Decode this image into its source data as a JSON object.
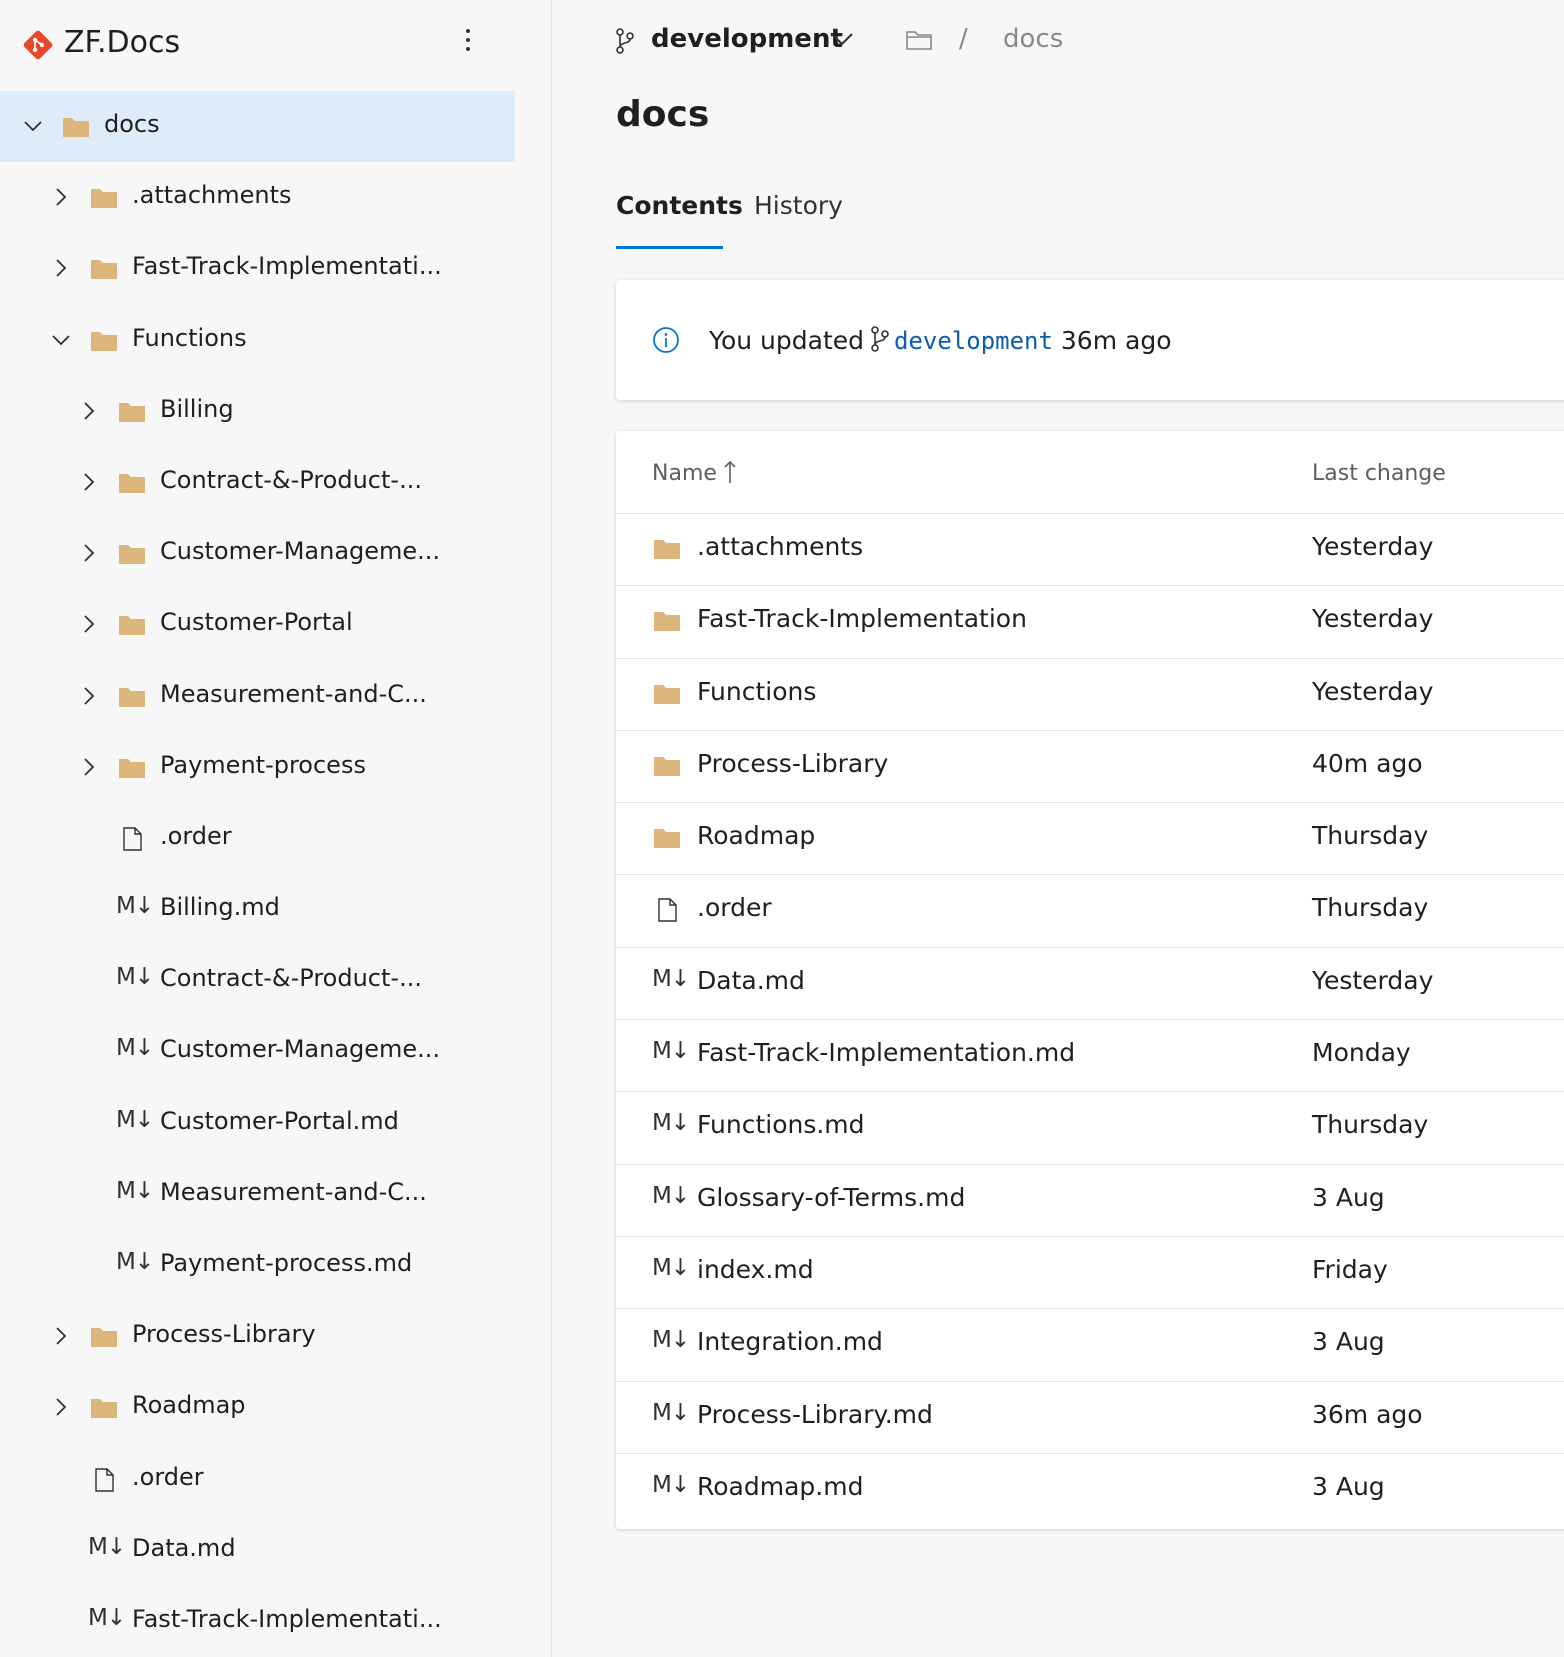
{
  "repo": {
    "name": "ZF.Docs",
    "logo_icon": "git-repo-diamond-icon",
    "accent": "#e8472b"
  },
  "sidebar": {
    "tree": [
      {
        "label": "docs",
        "type": "folder",
        "depth": 0,
        "expanded": true,
        "selected": true
      },
      {
        "label": ".attachments",
        "type": "folder",
        "depth": 1,
        "expanded": false
      },
      {
        "label": "Fast-Track-Implementati...",
        "type": "folder",
        "depth": 1,
        "expanded": false
      },
      {
        "label": "Functions",
        "type": "folder",
        "depth": 1,
        "expanded": true
      },
      {
        "label": "Billing",
        "type": "folder",
        "depth": 2,
        "expanded": false
      },
      {
        "label": "Contract-&-Product-...",
        "type": "folder",
        "depth": 2,
        "expanded": false
      },
      {
        "label": "Customer-Manageme...",
        "type": "folder",
        "depth": 2,
        "expanded": false
      },
      {
        "label": "Customer-Portal",
        "type": "folder",
        "depth": 2,
        "expanded": false
      },
      {
        "label": "Measurement-and-C...",
        "type": "folder",
        "depth": 2,
        "expanded": false
      },
      {
        "label": "Payment-process",
        "type": "folder",
        "depth": 2,
        "expanded": false
      },
      {
        "label": ".order",
        "type": "file",
        "depth": 2
      },
      {
        "label": "Billing.md",
        "type": "md",
        "depth": 2
      },
      {
        "label": "Contract-&-Product-...",
        "type": "md",
        "depth": 2
      },
      {
        "label": "Customer-Manageme...",
        "type": "md",
        "depth": 2
      },
      {
        "label": "Customer-Portal.md",
        "type": "md",
        "depth": 2
      },
      {
        "label": "Measurement-and-C...",
        "type": "md",
        "depth": 2
      },
      {
        "label": "Payment-process.md",
        "type": "md",
        "depth": 2
      },
      {
        "label": "Process-Library",
        "type": "folder",
        "depth": 1,
        "expanded": false
      },
      {
        "label": "Roadmap",
        "type": "folder",
        "depth": 1,
        "expanded": false
      },
      {
        "label": ".order",
        "type": "file",
        "depth": 1
      },
      {
        "label": "Data.md",
        "type": "md",
        "depth": 1
      },
      {
        "label": "Fast-Track-Implementati...",
        "type": "md",
        "depth": 1
      }
    ],
    "md_glyph": "M↓"
  },
  "header": {
    "branch": "development",
    "breadcrumb_sep": "/",
    "breadcrumb_current": "docs"
  },
  "page": {
    "title": "docs",
    "tabs": [
      {
        "label": "Contents",
        "active": true
      },
      {
        "label": "History",
        "active": false
      }
    ]
  },
  "info": {
    "prefix": "You updated",
    "branch": "development",
    "suffix": "36m ago"
  },
  "table": {
    "columns": {
      "name": "Name",
      "last_change": "Last change"
    },
    "sort": "ascending",
    "rows": [
      {
        "name": ".attachments",
        "type": "folder",
        "last_change": "Yesterday"
      },
      {
        "name": "Fast-Track-Implementation",
        "type": "folder",
        "last_change": "Yesterday"
      },
      {
        "name": "Functions",
        "type": "folder",
        "last_change": "Yesterday"
      },
      {
        "name": "Process-Library",
        "type": "folder",
        "last_change": "40m ago"
      },
      {
        "name": "Roadmap",
        "type": "folder",
        "last_change": "Thursday"
      },
      {
        "name": ".order",
        "type": "file",
        "last_change": "Thursday"
      },
      {
        "name": "Data.md",
        "type": "md",
        "last_change": "Yesterday"
      },
      {
        "name": "Fast-Track-Implementation.md",
        "type": "md",
        "last_change": "Monday"
      },
      {
        "name": "Functions.md",
        "type": "md",
        "last_change": "Thursday"
      },
      {
        "name": "Glossary-of-Terms.md",
        "type": "md",
        "last_change": "3 Aug"
      },
      {
        "name": "index.md",
        "type": "md",
        "last_change": "Friday"
      },
      {
        "name": "Integration.md",
        "type": "md",
        "last_change": "3 Aug"
      },
      {
        "name": "Process-Library.md",
        "type": "md",
        "last_change": "36m ago"
      },
      {
        "name": "Roadmap.md",
        "type": "md",
        "last_change": "3 Aug"
      }
    ]
  },
  "colors": {
    "folder": "#dcb67a",
    "selected_bg": "#deecf9",
    "tab_underline": "#0078d4",
    "link": "#0b5cad",
    "info_icon": "#0078d4"
  }
}
